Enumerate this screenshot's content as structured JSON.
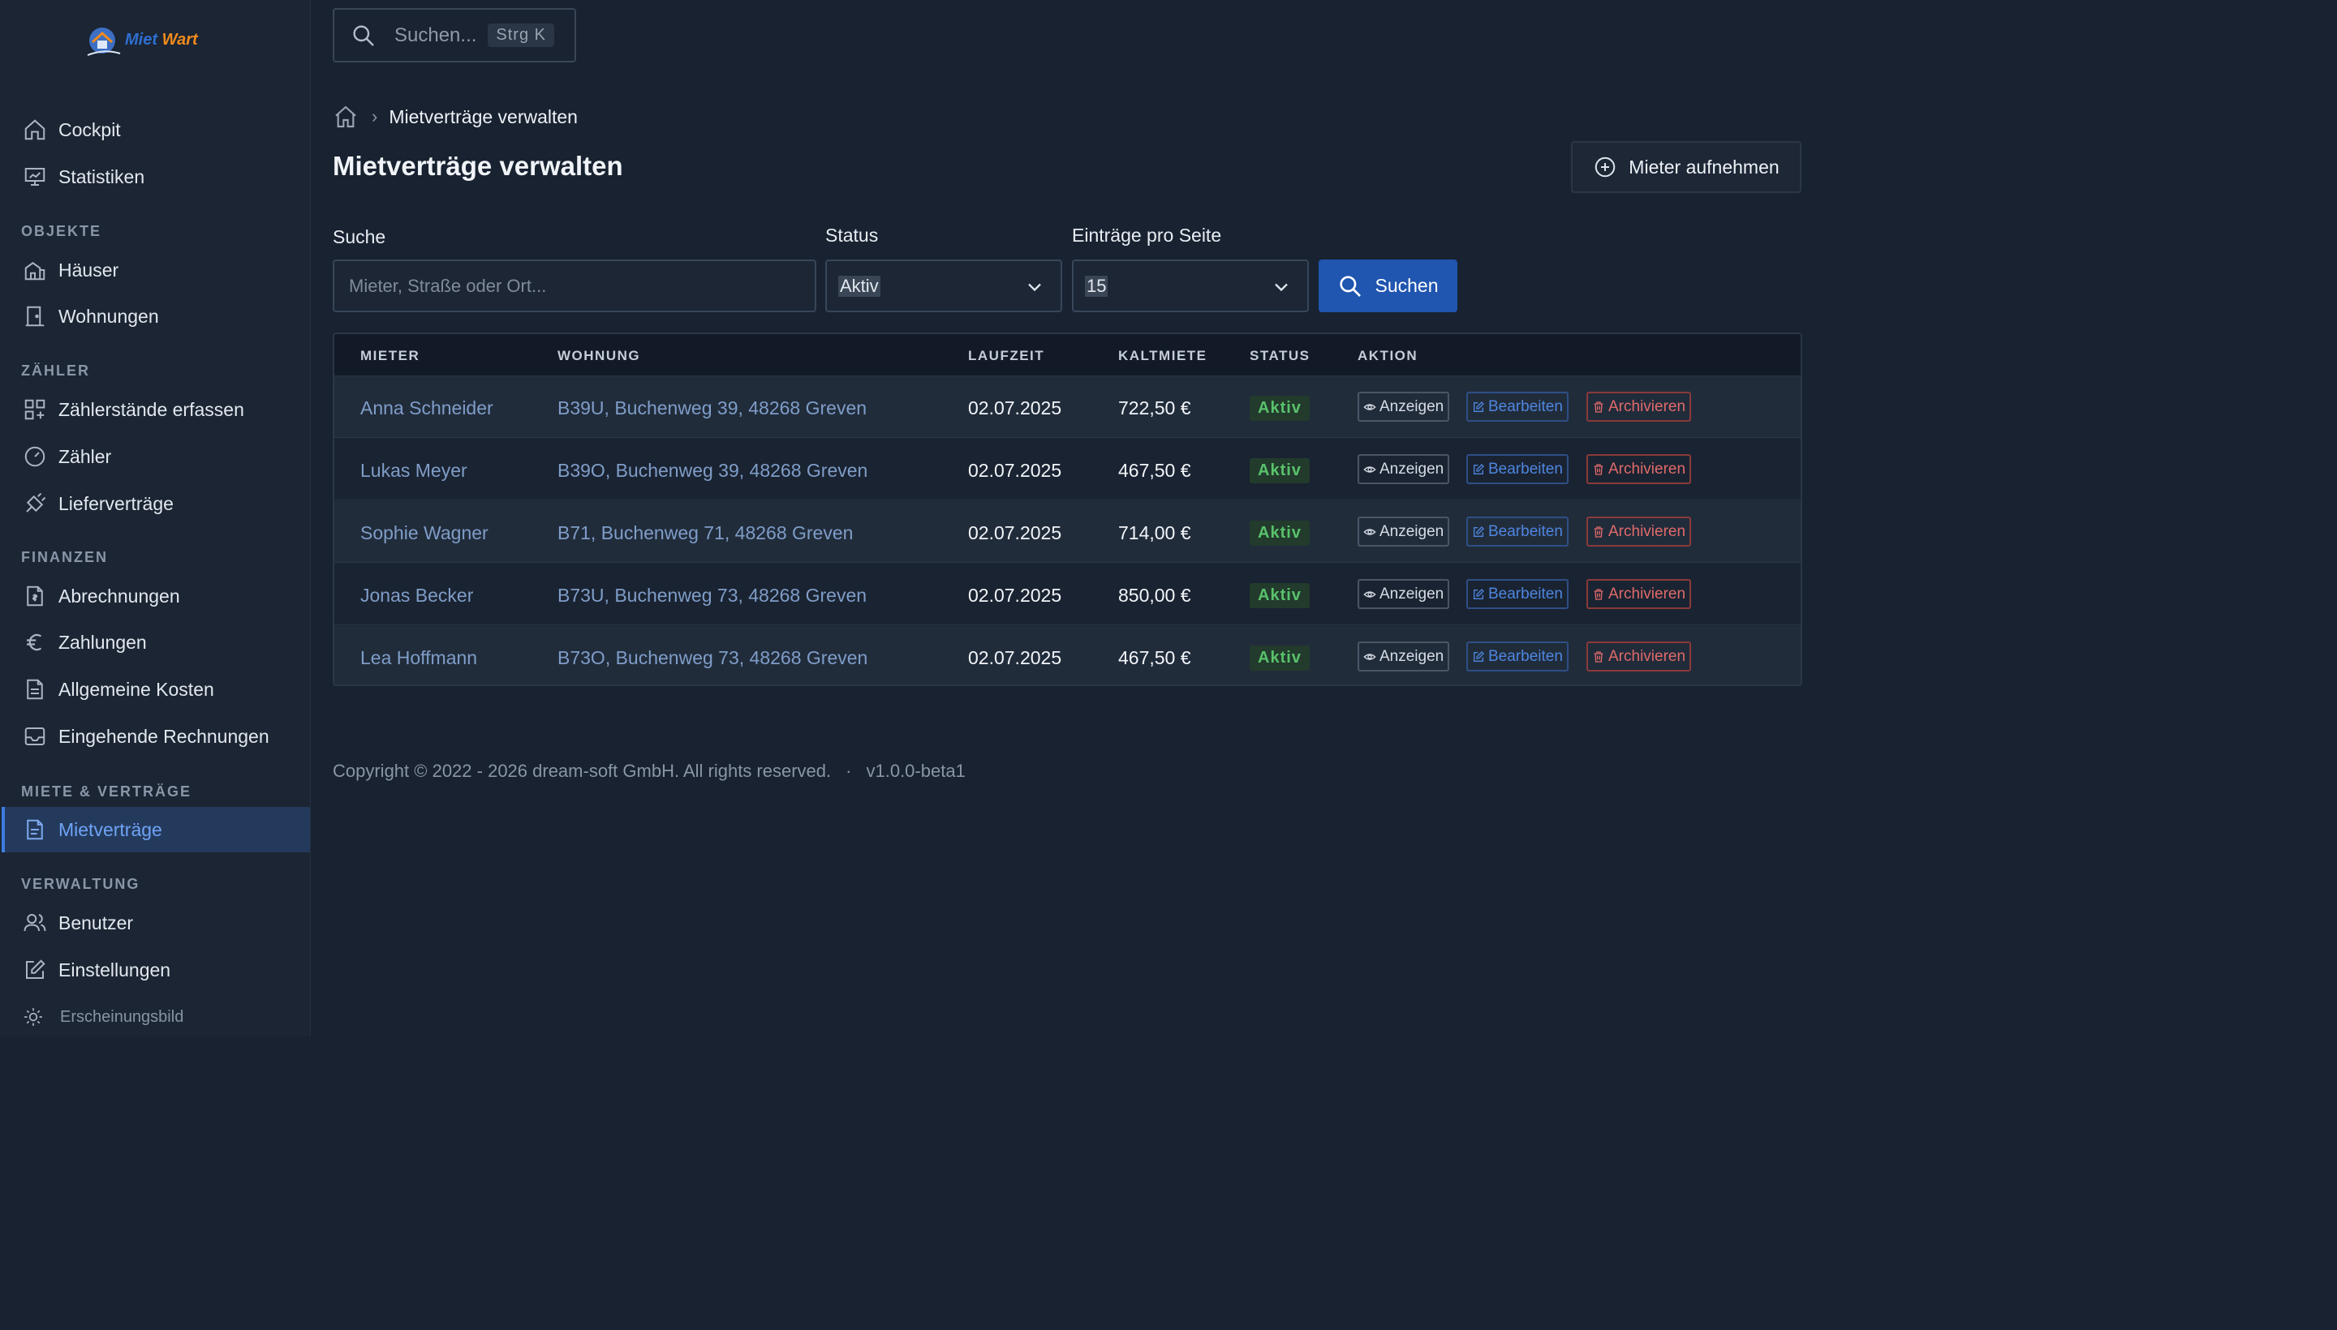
{
  "app": {
    "logo_part1": "Miet",
    "logo_part2": "Wart"
  },
  "topbar": {
    "search_placeholder": "Suchen...",
    "shortcut": "Strg K"
  },
  "sidebar": {
    "top_items": [
      {
        "label": "Cockpit",
        "icon": "home-icon"
      },
      {
        "label": "Statistiken",
        "icon": "presentation-chart-icon"
      }
    ],
    "sections": [
      {
        "title": "OBJEKTE",
        "items": [
          {
            "label": "Häuser",
            "icon": "building-icon"
          },
          {
            "label": "Wohnungen",
            "icon": "door-icon"
          }
        ]
      },
      {
        "title": "ZÄHLER",
        "items": [
          {
            "label": "Zählerstände erfassen",
            "icon": "grid-plus-icon"
          },
          {
            "label": "Zähler",
            "icon": "gauge-icon"
          },
          {
            "label": "Lieferverträge",
            "icon": "plug-icon"
          }
        ]
      },
      {
        "title": "FINANZEN",
        "items": [
          {
            "label": "Abrechnungen",
            "icon": "invoice-icon"
          },
          {
            "label": "Zahlungen",
            "icon": "euro-icon"
          },
          {
            "label": "Allgemeine Kosten",
            "icon": "document-icon"
          },
          {
            "label": "Eingehende Rechnungen",
            "icon": "inbox-icon"
          }
        ]
      },
      {
        "title": "MIETE & VERTRÄGE",
        "items": [
          {
            "label": "Mietverträge",
            "icon": "contract-icon",
            "active": true
          }
        ]
      },
      {
        "title": "VERWALTUNG",
        "items": [
          {
            "label": "Benutzer",
            "icon": "users-icon"
          },
          {
            "label": "Einstellungen",
            "icon": "edit-icon"
          },
          {
            "label": "Erscheinungsbild",
            "icon": "sun-icon"
          }
        ]
      }
    ]
  },
  "breadcrumb": {
    "current": "Mietverträge verwalten"
  },
  "page": {
    "title": "Mietverträge verwalten",
    "add_button": "Mieter aufnehmen"
  },
  "filters": {
    "search_label": "Suche",
    "search_placeholder": "Mieter, Straße oder Ort...",
    "status_label": "Status",
    "status_value": "Aktiv",
    "per_page_label": "Einträge pro Seite",
    "per_page_value": "15",
    "search_button": "Suchen"
  },
  "table": {
    "headers": [
      "MIETER",
      "WOHNUNG",
      "LAUFZEIT",
      "KALTMIETE",
      "STATUS",
      "AKTION"
    ],
    "actions": {
      "view": "Anzeigen",
      "edit": "Bearbeiten",
      "archive": "Archivieren"
    },
    "rows": [
      {
        "tenant": "Anna Schneider",
        "unit": "B39U, Buchenweg 39, 48268 Greven",
        "start": "02.07.2025",
        "rent": "722,50 €",
        "status": "Aktiv"
      },
      {
        "tenant": "Lukas Meyer",
        "unit": "B39O, Buchenweg 39, 48268 Greven",
        "start": "02.07.2025",
        "rent": "467,50 €",
        "status": "Aktiv"
      },
      {
        "tenant": "Sophie Wagner",
        "unit": "B71, Buchenweg 71, 48268 Greven",
        "start": "02.07.2025",
        "rent": "714,00 €",
        "status": "Aktiv"
      },
      {
        "tenant": "Jonas Becker",
        "unit": "B73U, Buchenweg 73, 48268 Greven",
        "start": "02.07.2025",
        "rent": "850,00 €",
        "status": "Aktiv"
      },
      {
        "tenant": "Lea Hoffmann",
        "unit": "B73O, Buchenweg 73, 48268 Greven",
        "start": "02.07.2025",
        "rent": "467,50 €",
        "status": "Aktiv"
      }
    ]
  },
  "footer": {
    "copyright": "Copyright © 2022 - 2026 dream-soft GmbH. All rights reserved.",
    "separator": "·",
    "version": "v1.0.0-beta1"
  },
  "colors": {
    "background": "#182230",
    "sidebar": "#1b2533",
    "accent": "#2055b0",
    "active_nav": "#243a5c",
    "link": "#7f9dc8",
    "success": "#59c26c",
    "danger": "#e06a6a"
  }
}
